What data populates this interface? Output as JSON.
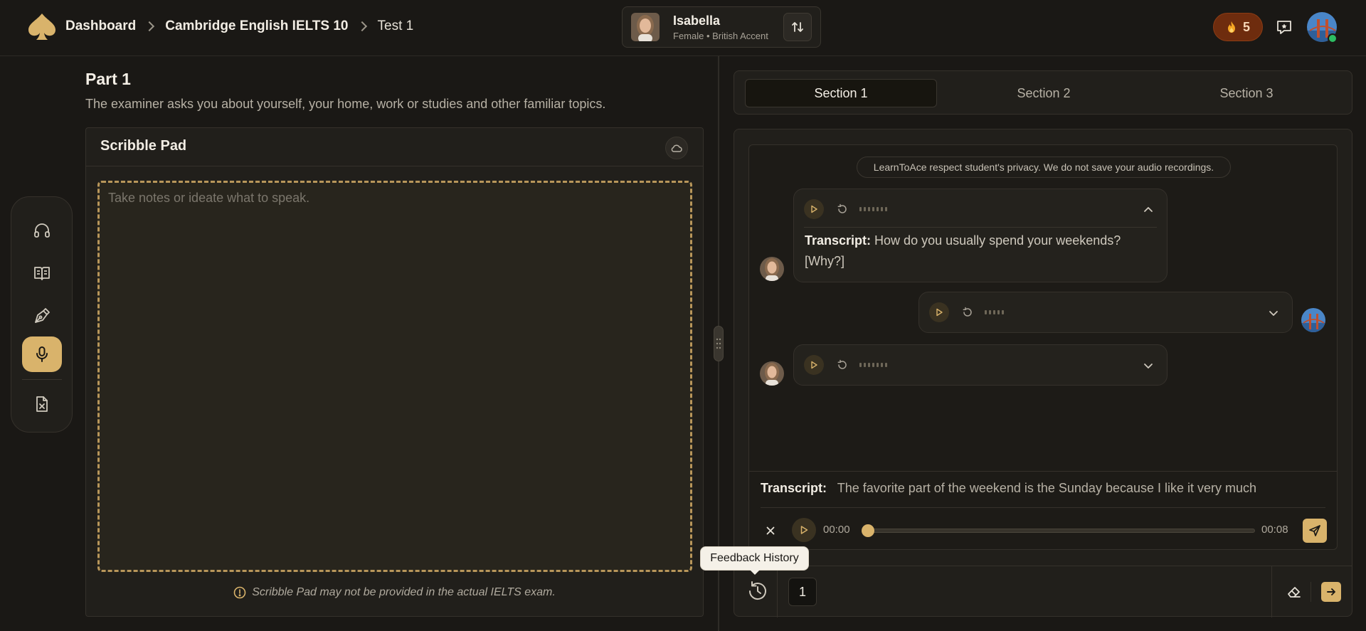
{
  "breadcrumb": {
    "items": [
      "Dashboard",
      "Cambridge English IELTS 10",
      "Test 1"
    ]
  },
  "voice": {
    "name": "Isabella",
    "details": "Female • British Accent"
  },
  "streak": {
    "count": "5"
  },
  "part": {
    "title": "Part 1",
    "description": "The examiner asks you about yourself, your home, work or studies and other familiar topics."
  },
  "scribble": {
    "title": "Scribble Pad",
    "placeholder": "Take notes or ideate what to speak.",
    "note": "Scribble Pad may not be provided in the actual IELTS exam."
  },
  "tabs": [
    {
      "label": "Section 1",
      "active": true
    },
    {
      "label": "Section 2",
      "active": false
    },
    {
      "label": "Section 3",
      "active": false
    }
  ],
  "chat": {
    "privacy": "LearnToAce respect student's privacy. We do not save your audio recordings.",
    "messages": [
      {
        "role": "examiner",
        "transcript_label": "Transcript:",
        "transcript": "How do you usually spend your weekends? [Why?]",
        "expanded": true
      },
      {
        "role": "user",
        "expanded": false
      },
      {
        "role": "examiner",
        "expanded": false
      }
    ]
  },
  "recorder": {
    "transcript_label": "Transcript:",
    "transcript": "The favorite part of the weekend is the Sunday because I like it very much",
    "current_time": "00:00",
    "total_time": "00:08",
    "progress": 0
  },
  "footer": {
    "page": "1",
    "tooltip": "Feedback History"
  },
  "colors": {
    "accent": "#d9b36b",
    "streak_bg": "#6e2c0e",
    "online": "#2dbd63"
  }
}
